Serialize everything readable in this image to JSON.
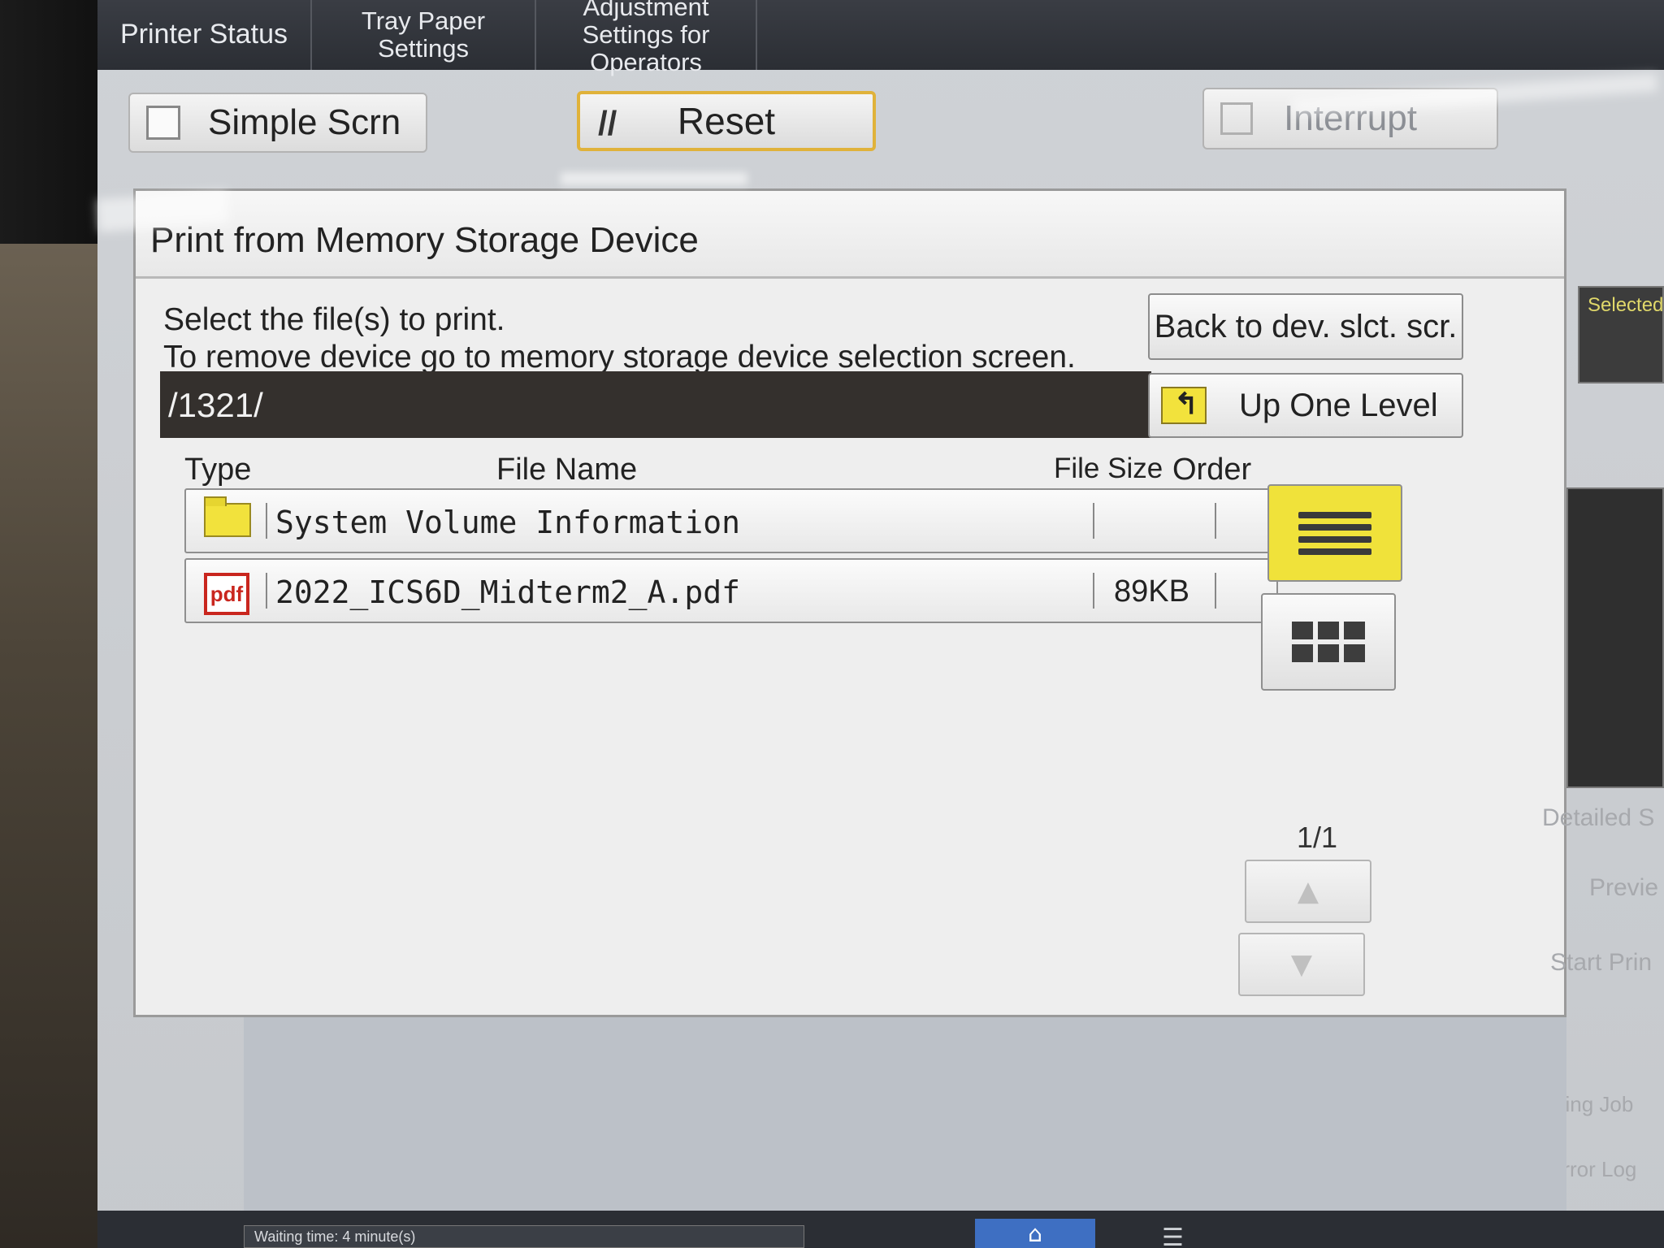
{
  "tabs": [
    "Printer Status",
    "Tray Paper Settings",
    "Adjustment Settings for Operators"
  ],
  "controls": {
    "simple_screen": "Simple Scrn",
    "reset": "Reset",
    "interrupt": "Interrupt"
  },
  "panel": {
    "title": "Print from Memory Storage Device",
    "instruction_line1": "Select the file(s) to print.",
    "instruction_line2": "To remove device go to memory storage device selection screen.",
    "back_button": "Back to dev. slct. scr.",
    "path": "/1321/",
    "up_button": "Up One Level"
  },
  "columns": {
    "type": "Type",
    "file_name": "File Name",
    "file_size": "File Size",
    "order": "Order"
  },
  "files": [
    {
      "type_icon": "folder-icon",
      "name": "System Volume Information",
      "size": ""
    },
    {
      "type_icon": "pdf-icon",
      "type_label": "pdf",
      "name": "2022_ICS6D_Midterm2_A.pdf",
      "size": "89KB"
    }
  ],
  "pagination": {
    "page": "1/1"
  },
  "right_panel": {
    "selected": "Selected",
    "detailed": "Detailed S",
    "preview": "Previe",
    "start": "Start Prin",
    "spooling": "Spooling Job",
    "error_log": "Error Log"
  },
  "status": {
    "waiting": "Waiting time: 4 minute(s)"
  },
  "colors": {
    "accent_yellow": "#f0e23a",
    "reset_border": "#e0b23a",
    "path_bg": "#34302d",
    "pdf_red": "#c9261e"
  }
}
